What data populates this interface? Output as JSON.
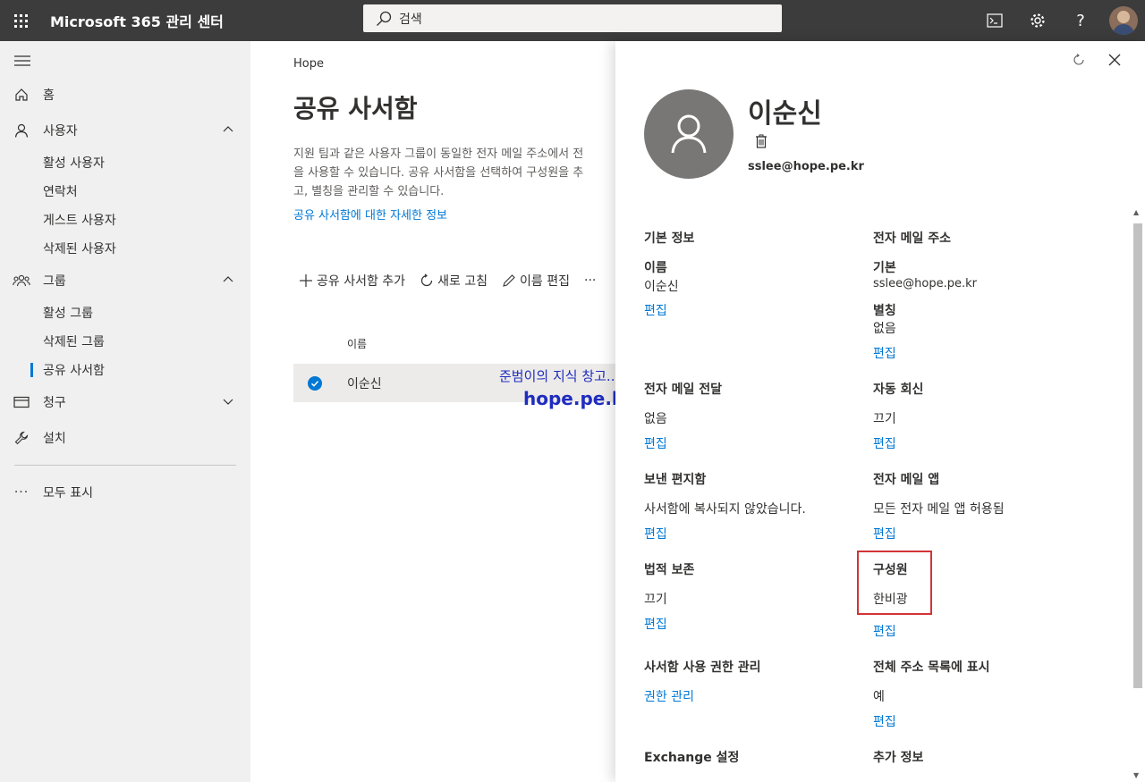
{
  "topbar": {
    "title": "Microsoft 365 관리 센터",
    "search_placeholder": "검색"
  },
  "nav": {
    "home": "홈",
    "users": "사용자",
    "users_sub": [
      "활성 사용자",
      "연락처",
      "게스트 사용자",
      "삭제된 사용자"
    ],
    "groups": "그룹",
    "groups_sub": [
      "활성 그룹",
      "삭제된 그룹",
      "공유 사서함"
    ],
    "billing": "청구",
    "setup": "설치",
    "show_all": "모두 표시"
  },
  "main": {
    "breadcrumb": "Hope",
    "title": "공유 사서함",
    "description_lines": [
      "지원 팀과 같은 사용자 그룹이 동일한 전자 메일 주소에서 전",
      "을 사용할 수 있습니다. 공유 사서함을 선택하여 구성원을 추",
      "고, 별칭을 관리할 수 있습니다."
    ],
    "learn_more": "공유 사서함에 대한 자세한 정보",
    "commands": {
      "add": "공유 사서함 추가",
      "refresh": "새로 고침",
      "edit_name": "이름 편집",
      "more": "···"
    },
    "column_name": "이름",
    "rows": [
      {
        "name": "이순신"
      }
    ],
    "watermark_line1": "준범이의 지식 창고...",
    "watermark_line2": "hope.pe.kr"
  },
  "panel": {
    "name": "이순신",
    "email": "sslee@hope.pe.kr",
    "basic_info": {
      "title": "기본 정보",
      "name_label": "이름",
      "name_value": "이순신",
      "edit": "편집"
    },
    "email_address": {
      "title": "전자 메일 주소",
      "primary_label": "기본",
      "primary_value": "sslee@hope.pe.kr",
      "alias_label": "별칭",
      "alias_value": "없음",
      "edit": "편집"
    },
    "forwarding": {
      "title": "전자 메일 전달",
      "value": "없음",
      "edit": "편집"
    },
    "auto_reply": {
      "title": "자동 회신",
      "value": "끄기",
      "edit": "편집"
    },
    "sent_items": {
      "title": "보낸 편지함",
      "value": "사서함에 복사되지 않았습니다.",
      "edit": "편집"
    },
    "email_apps": {
      "title": "전자 메일 앱",
      "value": "모든 전자 메일 앱 허용됨",
      "edit": "편집"
    },
    "litigation_hold": {
      "title": "법적 보존",
      "value": "끄기",
      "edit": "편집"
    },
    "members": {
      "title": "구성원",
      "value": "한비광",
      "edit": "편집"
    },
    "permissions": {
      "title": "사서함 사용 권한 관리",
      "link": "권한 관리"
    },
    "gal": {
      "title": "전체 주소 목록에 표시",
      "value": "예",
      "edit": "편집"
    },
    "exchange": {
      "title": "Exchange 설정"
    },
    "more_info": {
      "title": "추가 정보"
    }
  },
  "colors": {
    "accent": "#0078d4",
    "topbar": "#3c3c3c",
    "highlight": "#d13438"
  }
}
